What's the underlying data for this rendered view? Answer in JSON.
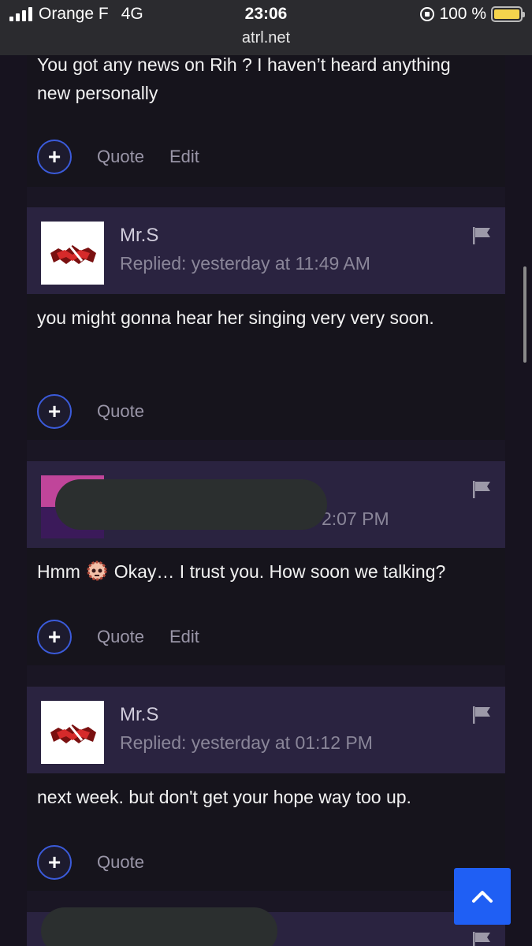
{
  "status_bar": {
    "carrier": "Orange F",
    "network": "4G",
    "time": "23:06",
    "url": "atrl.net",
    "battery": "100 %"
  },
  "posts": [
    {
      "text": "You got any news on Rih ? I haven’t heard anything new personally",
      "actions": [
        "Quote",
        "Edit"
      ]
    },
    {
      "username": "Mr.S",
      "replied": "Replied: yesterday at 11:49 AM",
      "text": "you might gonna hear her singing very very soon.",
      "actions": [
        "Quote"
      ]
    },
    {
      "replied_partial": "2:07 PM",
      "text": "Hmm 🤯 Okay… I trust you. How soon we talking?",
      "text_before": "Hmm",
      "text_after": "Okay… I trust you. How soon we talking?",
      "actions": [
        "Quote",
        "Edit"
      ]
    },
    {
      "username": "Mr.S",
      "replied": "Replied: yesterday at 01:12 PM",
      "text": "next week. but don't get your hope way too up.",
      "actions": [
        "Quote"
      ]
    }
  ],
  "icons": {
    "flag": "flag-icon",
    "plus": "plus-icon",
    "scroll_top": "chevron-up-icon"
  },
  "colors": {
    "accent": "#1f5ff4",
    "header_bg": "#2a2340",
    "page_bg": "#1a1624"
  }
}
